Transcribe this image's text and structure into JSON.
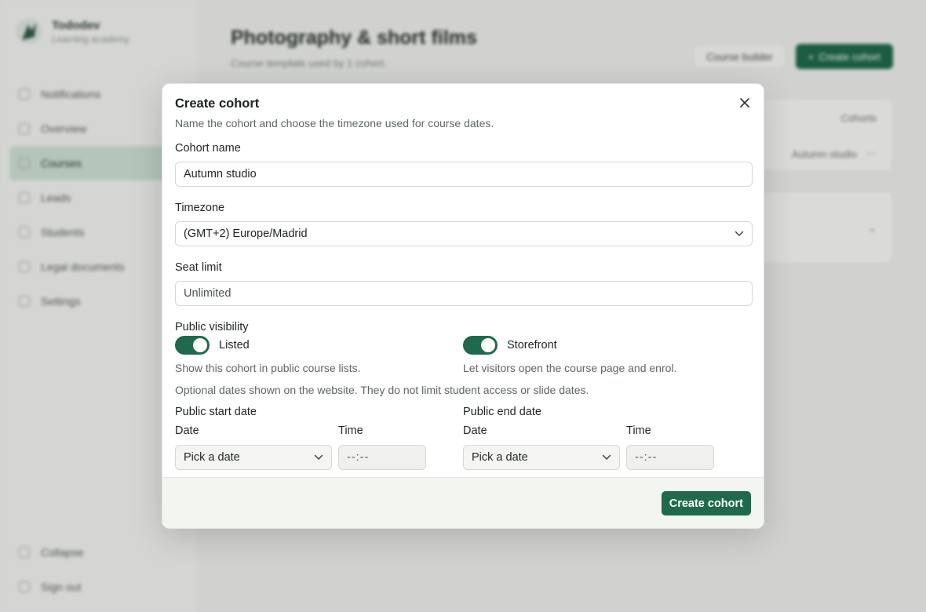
{
  "sidebar": {
    "brand": {
      "name": "Tododev",
      "tagline": "Learning academy"
    },
    "items": [
      {
        "label": "Notifications"
      },
      {
        "label": "Overview"
      },
      {
        "label": "Courses",
        "active": true
      },
      {
        "label": "Leads"
      },
      {
        "label": "Students"
      },
      {
        "label": "Legal documents"
      },
      {
        "label": "Settings"
      }
    ],
    "footer": [
      {
        "label": "Collapse"
      },
      {
        "label": "Sign out"
      }
    ]
  },
  "main": {
    "title": "Photography & short films",
    "subtitle": "Course template used by 1 cohort.",
    "course_builder_label": "Course builder",
    "create_cohort_label": "Create cohort",
    "card1_row1": "Cohorts",
    "card1_row2": "Autumn studio"
  },
  "modal": {
    "title": "Create cohort",
    "description": "Name the cohort and choose the timezone used for course dates.",
    "cohort_name": {
      "label": "Cohort name",
      "value": "Autumn studio"
    },
    "timezone": {
      "label": "Timezone",
      "value": "(GMT+2) Europe/Madrid"
    },
    "seat_limit": {
      "label": "Seat limit",
      "placeholder": "Unlimited"
    },
    "visibility": {
      "label": "Public visibility",
      "listed": {
        "label": "Listed",
        "hint": "Show this cohort in public course lists.",
        "on": true
      },
      "storefront": {
        "label": "Storefront",
        "hint": "Let visitors open the course page and enrol.",
        "on": true
      }
    },
    "dates_note": "Optional dates shown on the website. They do not limit student access or slide dates.",
    "start": {
      "label": "Public start date",
      "date_label": "Date",
      "time_label": "Time",
      "date_placeholder": "Pick a date",
      "time_placeholder": "--:--"
    },
    "end": {
      "label": "Public end date",
      "date_label": "Date",
      "time_label": "Time",
      "date_placeholder": "Pick a date",
      "time_placeholder": "--:--"
    },
    "submit_label": "Create cohort"
  },
  "colors": {
    "accent": "#1f6a4a",
    "active_nav": "#cfe1d3"
  }
}
